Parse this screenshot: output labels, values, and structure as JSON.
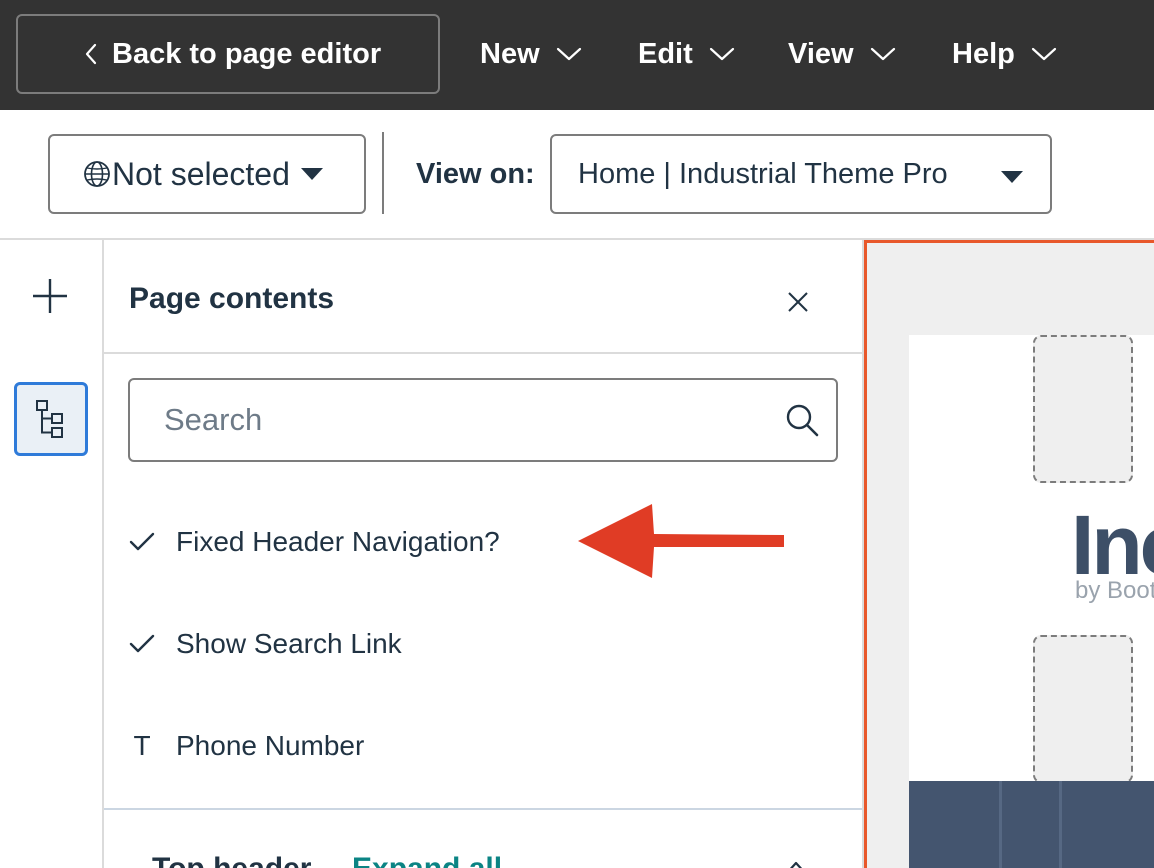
{
  "topbar": {
    "back_label": "Back to page editor",
    "menus": [
      {
        "label": "New"
      },
      {
        "label": "Edit"
      },
      {
        "label": "View"
      },
      {
        "label": "Help"
      }
    ]
  },
  "toolbar": {
    "language_label": "Not selected",
    "view_on_label": "View on:",
    "view_on_value": "Home | Industrial Theme Pro"
  },
  "panel": {
    "title": "Page contents",
    "search_placeholder": "Search",
    "items": [
      {
        "label": "Fixed Header Navigation?",
        "icon": "check-icon"
      },
      {
        "label": "Show Search Link",
        "icon": "check-icon"
      },
      {
        "label": "Phone Number",
        "icon": "text-t-icon",
        "glyph": "T"
      }
    ],
    "section_partial": "Top header",
    "expand_all": "Expand all"
  },
  "preview": {
    "logo_text": "Inc",
    "logo_sub": "by Boot"
  },
  "colors": {
    "topbar_bg": "#333333",
    "accent_blue": "#2f7bd9",
    "preview_border": "#e8582b",
    "annotation_arrow": "#e03c25",
    "link_teal": "#0b8484"
  }
}
